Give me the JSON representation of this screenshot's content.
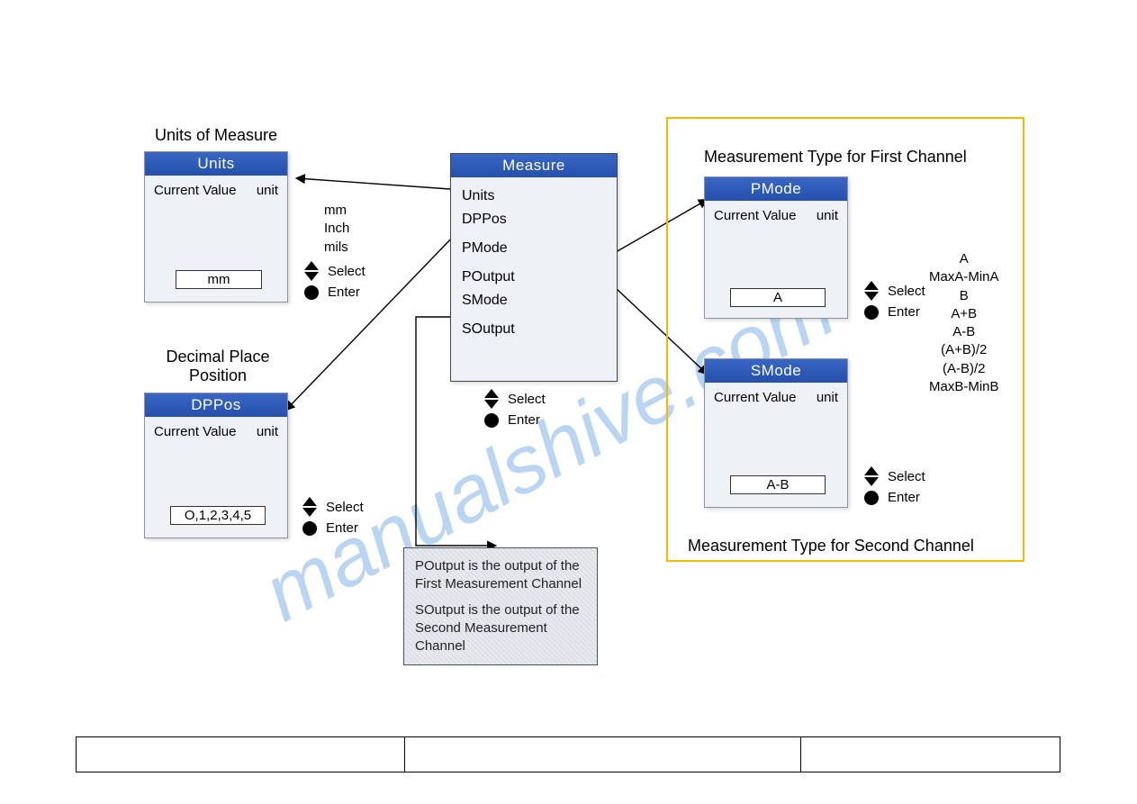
{
  "watermark": "manualshive.com",
  "labels": {
    "units_title": "Units of Measure",
    "dppos_title": "Decimal Place\nPosition",
    "first_ch": "Measurement Type for  First Channel",
    "second_ch": "Measurement Type for Second Channel"
  },
  "panels": {
    "units": {
      "header": "Units",
      "cv_label": "Current Value",
      "cv_unit": "unit",
      "value": "mm"
    },
    "dppos": {
      "header": "DPPos",
      "cv_label": "Current Value",
      "cv_unit": "unit",
      "value": "O,1,2,3,4,5"
    },
    "pmode": {
      "header": "PMode",
      "cv_label": "Current Value",
      "cv_unit": "unit",
      "value": "A"
    },
    "smode": {
      "header": "SMode",
      "cv_label": "Current Value",
      "cv_unit": "unit",
      "value": "A-B"
    }
  },
  "menu": {
    "header": "Measure",
    "items": [
      "Units",
      "DPPos",
      "PMode",
      "POutput",
      "SMode",
      "SOutput"
    ]
  },
  "controls": {
    "select": "Select",
    "enter": "Enter"
  },
  "options": {
    "units": [
      "mm",
      "Inch",
      "mils"
    ],
    "modes": [
      "A",
      "MaxA-MinA",
      "B",
      "A+B",
      "A-B",
      "(A+B)/2",
      "(A-B)/2",
      "MaxB-MinB"
    ]
  },
  "note": {
    "line1": "POutput is the output of the First Measurement Channel",
    "line2": "SOutput is the output of the Second Measurement Channel"
  }
}
